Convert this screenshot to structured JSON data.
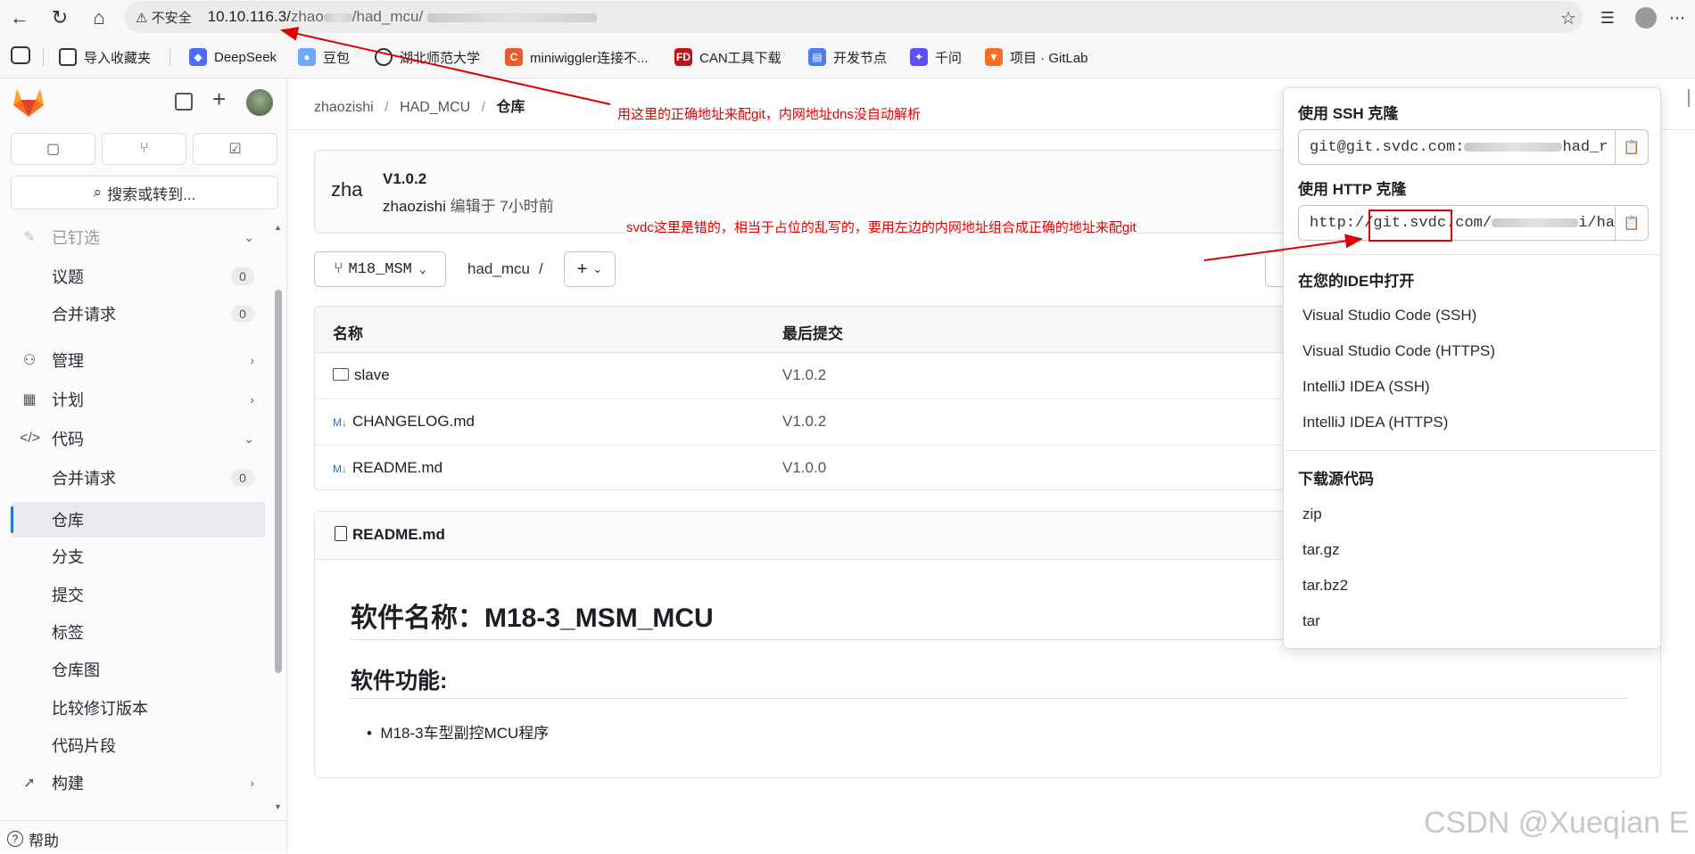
{
  "browser": {
    "security_label": "不安全",
    "url_host": "10.10.116.3/",
    "url_path_a": "zhao",
    "url_path_b": "/had_mcu/",
    "bookmarks": [
      "导入收藏夹",
      "DeepSeek",
      "豆包",
      "湖北师范大学",
      "miniwiggler连接不...",
      "CAN工具下载",
      "开发节点",
      "千问",
      "项目 · GitLab"
    ]
  },
  "sidebar": {
    "search_label": "搜索或转到...",
    "pinned_label": "已钉选",
    "items": [
      {
        "label": "议题",
        "count": "0"
      },
      {
        "label": "合并请求",
        "count": "0"
      },
      {
        "label": "管理"
      },
      {
        "label": "计划"
      },
      {
        "label": "代码"
      },
      {
        "label": "合并请求",
        "count": "0"
      },
      {
        "label": "仓库"
      },
      {
        "label": "分支"
      },
      {
        "label": "提交"
      },
      {
        "label": "标签"
      },
      {
        "label": "仓库图"
      },
      {
        "label": "比较修订版本"
      },
      {
        "label": "代码片段"
      },
      {
        "label": "构建"
      }
    ],
    "help_label": "帮助"
  },
  "breadcrumb": {
    "a": "zhaozishi",
    "b": "HAD_MCU",
    "c": "仓库",
    "sep": "/"
  },
  "commit": {
    "title": "V1.0.2",
    "author": "zhaozishi",
    "meta": "编辑于 7小时前",
    "avatar_text": "zha"
  },
  "repo_toolbar": {
    "branch": "M18_MSM",
    "path": "had_mcu",
    "path_sep": "/",
    "plus": "+"
  },
  "files": {
    "headers": [
      "名称",
      "最后提交"
    ],
    "rows": [
      {
        "name": "slave",
        "commit": "V1.0.2",
        "kind": "folder"
      },
      {
        "name": "CHANGELOG.md",
        "commit": "V1.0.2",
        "kind": "markdown"
      },
      {
        "name": "README.md",
        "commit": "V1.0.0",
        "kind": "markdown"
      }
    ]
  },
  "readme": {
    "filename": "README.md",
    "h1": "软件名称：M18-3_MSM_MCU",
    "h2": "软件功能:",
    "bullet": "M18-3车型副控MCU程序"
  },
  "clone": {
    "ssh_label": "使用 SSH 克隆",
    "ssh_value_a": "git@git.svdc.com:",
    "ssh_value_b": "had_r",
    "http_label": "使用 HTTP 克隆",
    "http_value_a": "http://",
    "http_value_b": "git.svdc",
    "http_value_c": ".com/",
    "http_value_d": "i/ha",
    "ide_label": "在您的IDE中打开",
    "ide_items": [
      "Visual Studio Code (SSH)",
      "Visual Studio Code (HTTPS)",
      "IntelliJ IDEA (SSH)",
      "IntelliJ IDEA (HTTPS)"
    ],
    "download_label": "下载源代码",
    "download_items": [
      "zip",
      "tar.gz",
      "tar.bz2",
      "tar"
    ]
  },
  "annotations": {
    "note1": "用这里的正确地址来配git，内网地址dns没自动解析",
    "note2": "svdc这里是错的，相当于占位的乱写的，要用左边的内网地址组合成正确的地址来配git",
    "color": "#e00000"
  },
  "watermark": "CSDN @Xueqian E",
  "colors": {
    "accent": "#1f75cb",
    "gitlab_orange": "#fc6d26",
    "annotation_red": "#e00000"
  }
}
